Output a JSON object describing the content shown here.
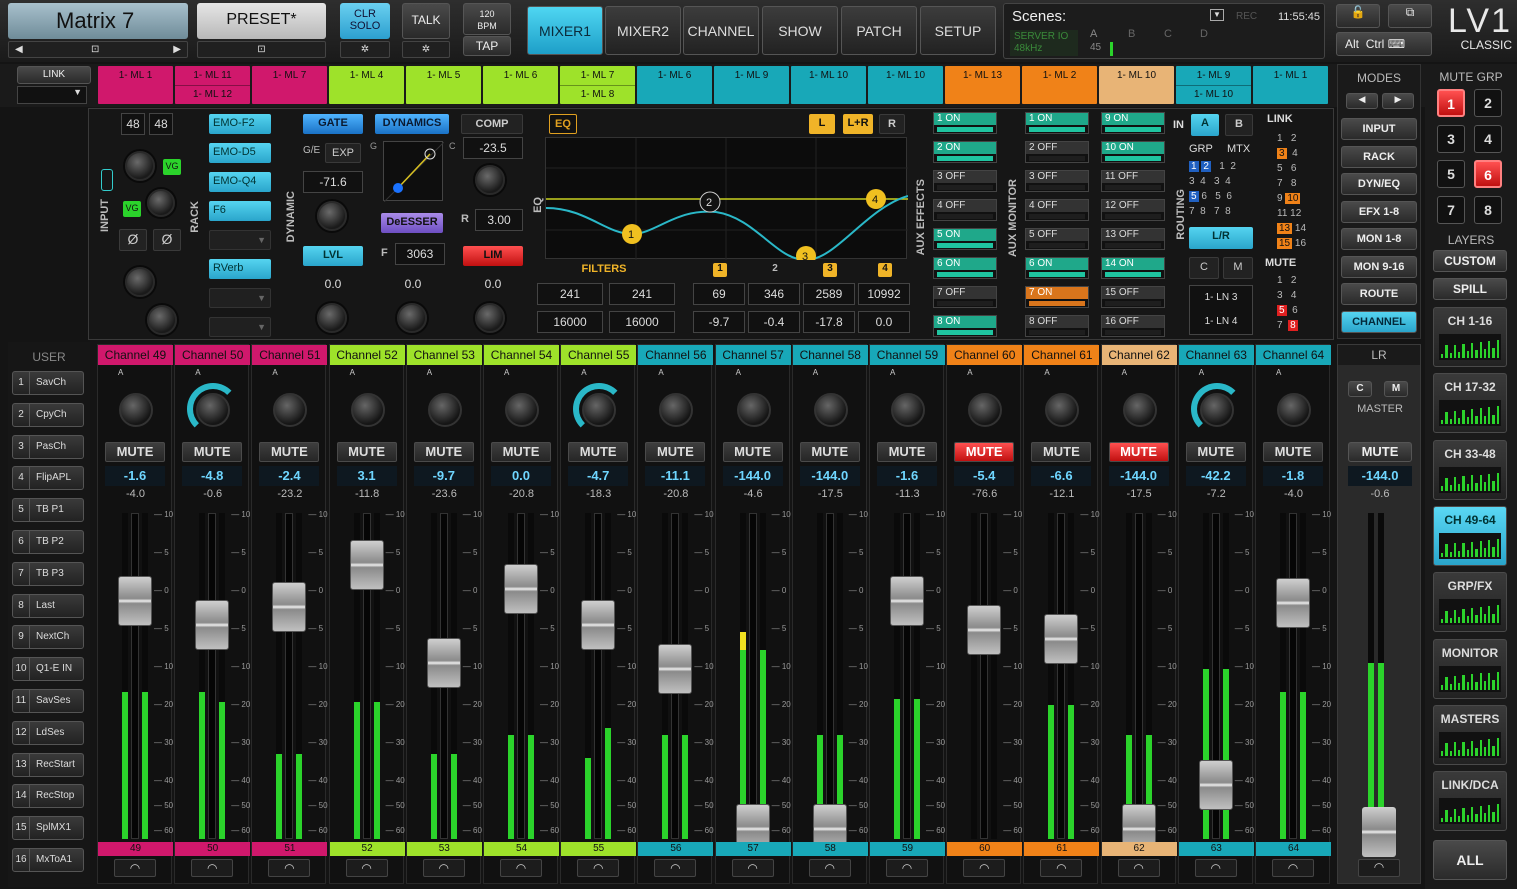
{
  "header": {
    "title": "Matrix 7",
    "preset": "PRESET*",
    "clr_solo": "CLR\nSOLO",
    "clr_l1": "CLR",
    "clr_l2": "SOLO",
    "talk": "TALK",
    "bpm": "120",
    "bpm_label": "BPM",
    "tap": "TAP",
    "tabs": [
      "MIXER1",
      "MIXER2",
      "CHANNEL",
      "SHOW",
      "PATCH",
      "SETUP"
    ],
    "active_tab": "MIXER1",
    "scenes_label": "Scenes:",
    "rec": "REC",
    "time": "11:55:45",
    "server": "SERVER IO",
    "rate": "48kHz",
    "abcd": [
      "A",
      "B",
      "C",
      "D"
    ],
    "count": "45",
    "alt": "Alt",
    "ctrl": "Ctrl",
    "logo_top": "LV1",
    "logo_bottom": "CLASSIC"
  },
  "link_label": "LINK",
  "links": [
    {
      "a": "1- ML 1",
      "b": "",
      "color": "#d0186c"
    },
    {
      "a": "1- ML 11",
      "b": "1- ML 12",
      "color": "#d0186c"
    },
    {
      "a": "1- ML 7",
      "b": "",
      "color": "#d0186c"
    },
    {
      "a": "1- ML 4",
      "b": "",
      "color": "#9ee22a"
    },
    {
      "a": "1- ML 5",
      "b": "",
      "color": "#9ee22a"
    },
    {
      "a": "1- ML 6",
      "b": "",
      "color": "#9ee22a"
    },
    {
      "a": "1- ML 7",
      "b": "1- ML 8",
      "color": "#9ee22a"
    },
    {
      "a": "1- ML 6",
      "b": "",
      "color": "#18a8b8"
    },
    {
      "a": "1- ML 9",
      "b": "",
      "color": "#18a8b8"
    },
    {
      "a": "1- ML 10",
      "b": "",
      "color": "#18a8b8"
    },
    {
      "a": "1- ML 10",
      "b": "",
      "color": "#18a8b8"
    },
    {
      "a": "1- ML 13",
      "b": "",
      "color": "#f08218"
    },
    {
      "a": "1- ML 2",
      "b": "",
      "color": "#f08218"
    },
    {
      "a": "1- ML 10",
      "b": "",
      "color": "#e8b476"
    },
    {
      "a": "1- ML 9",
      "b": "1- ML 10",
      "color": "#18a8b8"
    },
    {
      "a": "1- ML 1",
      "b": "",
      "color": "#18a8b8"
    }
  ],
  "strip": {
    "v48a": "48",
    "v48b": "48",
    "input": "INPUT",
    "vg": "VG",
    "phase": "Ø",
    "rack": "RACK",
    "rack_slots": [
      "EMO-F2",
      "EMO-D5",
      "EMO-Q4",
      "F6",
      "",
      "RVerb",
      "",
      ""
    ],
    "dynamic": "DYNAMIC",
    "gate": "GATE",
    "ge": "G/E",
    "exp": "EXP",
    "gate_thr": "-71.6",
    "lvl": "LVL",
    "lvl_val": "0.0",
    "dynamics": "DYNAMICS",
    "deesser": "DeESSER",
    "f_label": "F",
    "f_val": "3063",
    "g_label": "G",
    "c_label": "C",
    "dyn_val": "0.0",
    "comp": "COMP",
    "comp_thr": "-23.5",
    "r_label": "R",
    "ratio": "3.00",
    "lim": "LIM",
    "comp_val": "0.0",
    "eq": "EQ",
    "eq_side": "EQ",
    "L": "L",
    "LR": "L+R",
    "R": "R",
    "filters": "FILTERS",
    "hp1": "241",
    "hp2": "241",
    "lp1": "16000",
    "lp2": "16000",
    "bands": [
      "1",
      "2",
      "3",
      "4"
    ],
    "band_f": [
      "69",
      "346",
      "2589",
      "10992"
    ],
    "band_g": [
      "-9.7",
      "-0.4",
      "-17.8",
      "0.0"
    ],
    "f_row": "F",
    "g_row": "G",
    "aux_effects": "AUX EFFECTS",
    "fx": [
      {
        "t": "1 ON",
        "on": true
      },
      {
        "t": "2 ON",
        "on": true
      },
      {
        "t": "3 OFF",
        "on": false
      },
      {
        "t": "4 OFF",
        "on": false
      },
      {
        "t": "5 ON",
        "on": true
      },
      {
        "t": "6 ON",
        "on": true
      },
      {
        "t": "7 OFF",
        "on": false
      },
      {
        "t": "8 ON",
        "on": true
      }
    ],
    "aux_monitor": "AUX MONITOR",
    "mon1": [
      {
        "t": "1 ON",
        "on": true
      },
      {
        "t": "2 OFF",
        "on": false
      },
      {
        "t": "3 OFF",
        "on": false
      },
      {
        "t": "4 OFF",
        "on": false
      },
      {
        "t": "5 OFF",
        "on": false
      },
      {
        "t": "6 ON",
        "on": true
      },
      {
        "t": "7 ON",
        "on": true,
        "o": true
      },
      {
        "t": "8 OFF",
        "on": false
      }
    ],
    "mon2": [
      {
        "t": "9 ON",
        "on": true
      },
      {
        "t": "10 ON",
        "on": true
      },
      {
        "t": "11 OFF",
        "on": false
      },
      {
        "t": "12 OFF",
        "on": false
      },
      {
        "t": "13 OFF",
        "on": false
      },
      {
        "t": "14 ON",
        "on": true
      },
      {
        "t": "15 OFF",
        "on": false
      },
      {
        "t": "16 OFF",
        "on": false
      }
    ],
    "routing": "ROUTING",
    "in": "IN",
    "a": "A",
    "b": "B",
    "grp": "GRP",
    "mtx": "MTX",
    "lr": "L/R",
    "c": "C",
    "m": "M",
    "ln3": "1- LN 3",
    "ln4": "1- LN 4",
    "link": "LINK",
    "mute": "MUTE"
  },
  "modes": {
    "title": "MODES",
    "items": [
      "INPUT",
      "RACK",
      "DYN/EQ",
      "EFX 1-8",
      "MON 1-8",
      "MON 9-16",
      "ROUTE",
      "CHANNEL"
    ],
    "active": "CHANNEL"
  },
  "mute_grp": {
    "title": "MUTE GRP",
    "items": [
      "1",
      "2",
      "3",
      "4",
      "5",
      "6",
      "7",
      "8"
    ]
  },
  "layers": {
    "title": "LAYERS",
    "custom": "CUSTOM",
    "spill": "SPILL",
    "items": [
      "CH 1-16",
      "CH 17-32",
      "CH 33-48",
      "CH 49-64",
      "GRP/FX",
      "MONITOR",
      "MASTERS",
      "LINK/DCA"
    ],
    "active": "CH 49-64",
    "all": "ALL"
  },
  "user": {
    "title": "USER",
    "keys": [
      {
        "n": "1",
        "l": "SavCh"
      },
      {
        "n": "2",
        "l": "CpyCh"
      },
      {
        "n": "3",
        "l": "PasCh"
      },
      {
        "n": "4",
        "l": "FlipAPL"
      },
      {
        "n": "5",
        "l": "TB P1"
      },
      {
        "n": "6",
        "l": "TB P2"
      },
      {
        "n": "7",
        "l": "TB P3"
      },
      {
        "n": "8",
        "l": "Last"
      },
      {
        "n": "9",
        "l": "NextCh"
      },
      {
        "n": "10",
        "l": "Q1-E IN"
      },
      {
        "n": "11",
        "l": "SavSes"
      },
      {
        "n": "12",
        "l": "LdSes"
      },
      {
        "n": "13",
        "l": "RecStart"
      },
      {
        "n": "14",
        "l": "RecStop"
      },
      {
        "n": "15",
        "l": "SplMX1"
      },
      {
        "n": "16",
        "l": "MxToA1"
      }
    ]
  },
  "channels": [
    {
      "name": "Channel 49",
      "num": "49",
      "color": "#d0186c",
      "gain": "-1.6",
      "peak": "-4.0",
      "mute": false,
      "fader": -1.6,
      "meter": [
        0.45,
        0.45
      ]
    },
    {
      "name": "Channel 50",
      "num": "50",
      "color": "#d0186c",
      "gain": "-4.8",
      "peak": "-0.6",
      "mute": false,
      "fader": -4.8,
      "meter": [
        0.45,
        0.42
      ],
      "arc": true
    },
    {
      "name": "Channel 51",
      "num": "51",
      "color": "#d0186c",
      "gain": "-2.4",
      "peak": "-23.2",
      "mute": false,
      "fader": -2.4,
      "meter": [
        0.26,
        0.26
      ]
    },
    {
      "name": "Channel 52",
      "num": "52",
      "color": "#9ee22a",
      "gain": "3.1",
      "peak": "-11.8",
      "mute": false,
      "fader": 3.1,
      "meter": [
        0.42,
        0.42
      ]
    },
    {
      "name": "Channel 53",
      "num": "53",
      "color": "#9ee22a",
      "gain": "-9.7",
      "peak": "-23.6",
      "mute": false,
      "fader": -9.7,
      "meter": [
        0.26,
        0.26
      ]
    },
    {
      "name": "Channel 54",
      "num": "54",
      "color": "#9ee22a",
      "gain": "0.0",
      "peak": "-20.8",
      "mute": false,
      "fader": 0.0,
      "meter": [
        0.32,
        0.32
      ]
    },
    {
      "name": "Channel 55",
      "num": "55",
      "color": "#9ee22a",
      "gain": "-4.7",
      "peak": "-18.3",
      "mute": false,
      "fader": -4.7,
      "meter": [
        0.25,
        0.34
      ],
      "arc": true
    },
    {
      "name": "Channel 56",
      "num": "56",
      "color": "#18a8b8",
      "gain": "-11.1",
      "peak": "-20.8",
      "mute": false,
      "fader": -11.1,
      "meter": [
        0.32,
        0.32
      ]
    },
    {
      "name": "Channel 57",
      "num": "57",
      "color": "#18a8b8",
      "gain": "-144.0",
      "peak": "-4.6",
      "mute": false,
      "fader": -144,
      "meter": [
        0.58,
        0.58
      ],
      "peakhold": true
    },
    {
      "name": "Channel 58",
      "num": "58",
      "color": "#18a8b8",
      "gain": "-144.0",
      "peak": "-17.5",
      "mute": false,
      "fader": -144,
      "meter": [
        0.32,
        0.32
      ]
    },
    {
      "name": "Channel 59",
      "num": "59",
      "color": "#18a8b8",
      "gain": "-1.6",
      "peak": "-11.3",
      "mute": false,
      "fader": -1.6,
      "meter": [
        0.43,
        0.43
      ]
    },
    {
      "name": "Channel 60",
      "num": "60",
      "color": "#f08218",
      "gain": "-5.4",
      "peak": "-76.6",
      "mute": true,
      "fader": -5.4,
      "meter": [
        0.0,
        0.0
      ]
    },
    {
      "name": "Channel 61",
      "num": "61",
      "color": "#f08218",
      "gain": "-6.6",
      "peak": "-12.1",
      "mute": false,
      "fader": -6.6,
      "meter": [
        0.41,
        0.41
      ]
    },
    {
      "name": "Channel 62",
      "num": "62",
      "color": "#e8b476",
      "gain": "-144.0",
      "peak": "-17.5",
      "mute": true,
      "fader": -144,
      "meter": [
        0.32,
        0.32
      ]
    },
    {
      "name": "Channel 63",
      "num": "63",
      "color": "#18a8b8",
      "gain": "-42.2",
      "peak": "-7.2",
      "mute": false,
      "fader": -42.2,
      "meter": [
        0.52,
        0.52
      ],
      "arc": true
    },
    {
      "name": "Channel 64",
      "num": "64",
      "color": "#18a8b8",
      "gain": "-1.8",
      "peak": "-4.0",
      "mute": false,
      "fader": -1.8,
      "meter": [
        0.45,
        0.45
      ]
    }
  ],
  "master": {
    "name": "LR",
    "c": "C",
    "m": "M",
    "label": "MASTER",
    "mute": "MUTE",
    "gain": "-144.0",
    "peak": "-0.6",
    "meter": [
      0.54,
      0.54
    ]
  },
  "scale": [
    "10",
    "5",
    "0",
    "5",
    "10",
    "20",
    "30",
    "40",
    "50",
    "60"
  ]
}
